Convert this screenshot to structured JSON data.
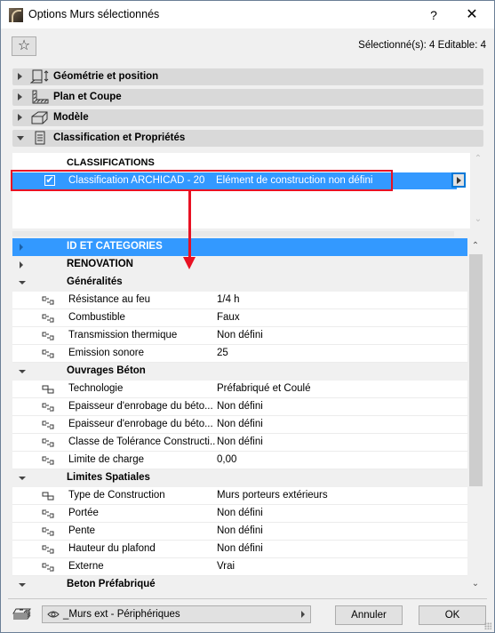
{
  "window": {
    "title": "Options Murs sélectionnés",
    "help_label": "?",
    "close_label": "✕"
  },
  "toolbar": {
    "favorites_icon": "☆",
    "selection_info": "Sélectionné(s): 4 Editable: 4"
  },
  "sections": [
    {
      "label": "Géométrie et position",
      "expanded": false,
      "icon": "geometry-icon"
    },
    {
      "label": "Plan et Coupe",
      "expanded": false,
      "icon": "floor-plan-section-icon"
    },
    {
      "label": "Modèle",
      "expanded": false,
      "icon": "model-icon"
    },
    {
      "label": "Classification et Propriétés",
      "expanded": true,
      "icon": "document-icon"
    }
  ],
  "classifications": {
    "header": "CLASSIFICATIONS",
    "rows": [
      {
        "checked": true,
        "system": "Classification ARCHICAD - 20",
        "value": "Elément de construction non défini"
      }
    ]
  },
  "annotation": {
    "highlight_color": "#e81123"
  },
  "properties": {
    "groups": [
      {
        "label": "ID ET CATEGORIES",
        "expanded": false,
        "selected": true,
        "items": []
      },
      {
        "label": "RENOVATION",
        "expanded": false,
        "selected": false,
        "items": []
      },
      {
        "label": "Généralités",
        "expanded": true,
        "selected": false,
        "items": [
          {
            "icon": "linked-property-icon",
            "name": "Résistance au feu",
            "value": "1/4 h"
          },
          {
            "icon": "linked-property-icon",
            "name": "Combustible",
            "value": "Faux"
          },
          {
            "icon": "linked-property-icon",
            "name": "Transmission thermique",
            "value": "Non défini"
          },
          {
            "icon": "linked-property-icon",
            "name": "Emission sonore",
            "value": " 25"
          }
        ]
      },
      {
        "label": "Ouvrages Béton",
        "expanded": true,
        "selected": false,
        "items": [
          {
            "icon": "custom-property-icon",
            "name": "Technologie",
            "value": "Préfabriqué et Coulé"
          },
          {
            "icon": "linked-property-icon",
            "name": "Epaisseur d'enrobage du béto...",
            "value": "Non défini"
          },
          {
            "icon": "linked-property-icon",
            "name": "Epaisseur d'enrobage du béto...",
            "value": "Non défini"
          },
          {
            "icon": "linked-property-icon",
            "name": "Classe de Tolérance Constructi...",
            "value": "Non défini"
          },
          {
            "icon": "linked-property-icon",
            "name": "Limite de charge",
            "value": " 0,00"
          }
        ]
      },
      {
        "label": "Limites Spatiales",
        "expanded": true,
        "selected": false,
        "items": [
          {
            "icon": "custom-property-icon",
            "name": "Type de Construction",
            "value": "Murs porteurs extérieurs"
          },
          {
            "icon": "linked-property-icon",
            "name": "Portée",
            "value": "Non défini"
          },
          {
            "icon": "linked-property-icon",
            "name": "Pente",
            "value": "Non défini"
          },
          {
            "icon": "linked-property-icon",
            "name": "Hauteur du plafond",
            "value": "Non défini"
          },
          {
            "icon": "linked-property-icon",
            "name": "Externe",
            "value": "Vrai"
          }
        ]
      },
      {
        "label": "Beton Préfabriqué",
        "expanded": true,
        "selected": false,
        "items": []
      }
    ]
  },
  "footer": {
    "layer_name": "_Murs ext - Périphériques",
    "cancel_label": "Annuler",
    "ok_label": "OK"
  }
}
